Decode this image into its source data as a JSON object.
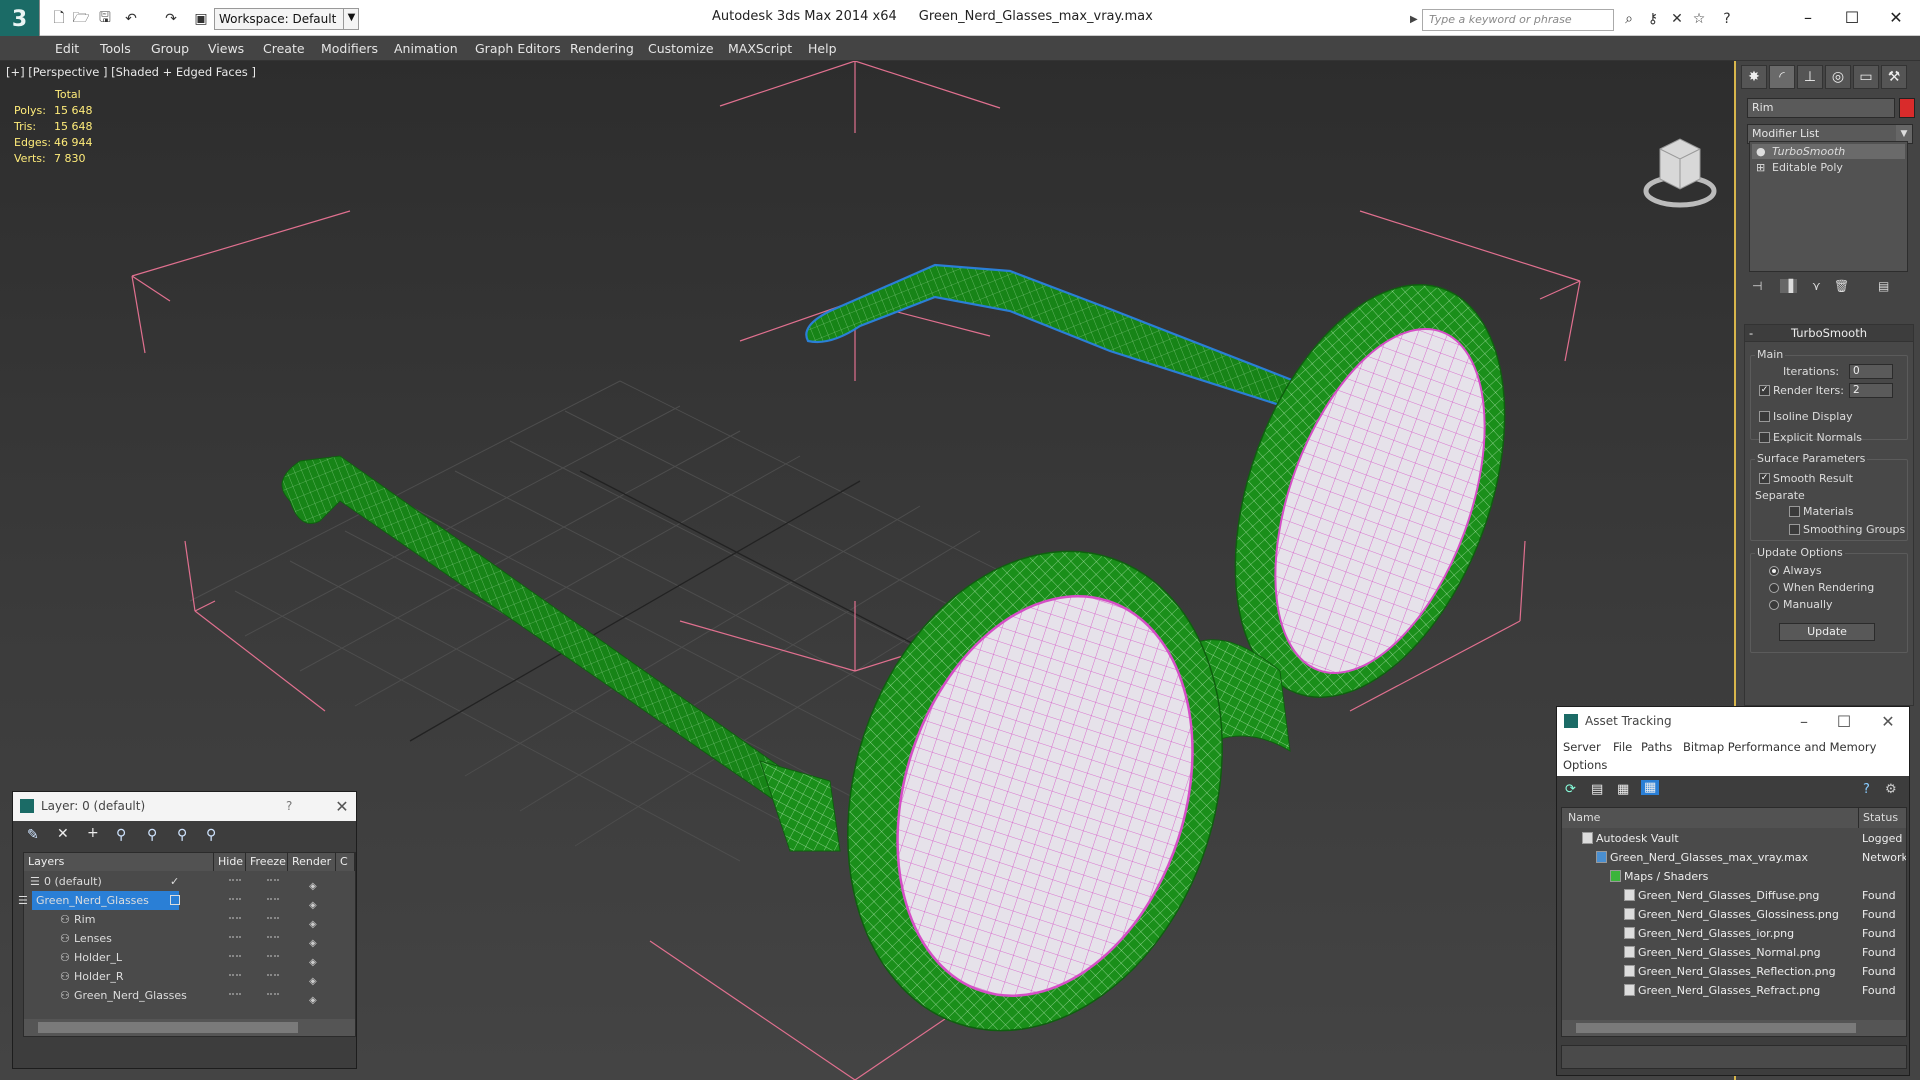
{
  "titlebar": {
    "workspace": "Workspace: Default",
    "app": "Autodesk 3ds Max  2014 x64",
    "file": "Green_Nerd_Glasses_max_vray.max",
    "search_placeholder": "Type a keyword or phrase"
  },
  "menu": [
    "Edit",
    "Tools",
    "Group",
    "Views",
    "Create",
    "Modifiers",
    "Animation",
    "Graph Editors",
    "Rendering",
    "Customize",
    "MAXScript",
    "Help"
  ],
  "viewport": {
    "label": "[+] [Perspective ] [Shaded + Edged Faces ]",
    "stats": {
      "header": "Total",
      "rows": [
        {
          "k": "Polys:",
          "v": "15 648"
        },
        {
          "k": "Tris:",
          "v": "15 648"
        },
        {
          "k": "Edges:",
          "v": "46 944"
        },
        {
          "k": "Verts:",
          "v": "7 830"
        }
      ]
    }
  },
  "command_panel": {
    "object_name": "Rim",
    "object_color": "#d92b2b",
    "modifier_list": "Modifier List",
    "stack": [
      "TurboSmooth",
      "Editable Poly"
    ],
    "turbosmooth": {
      "title": "TurboSmooth",
      "main_label": "Main",
      "iterations_label": "Iterations:",
      "iterations": "0",
      "render_iters_label": "Render Iters:",
      "render_iters": "2",
      "render_iters_checked": true,
      "isoline": "Isoline Display",
      "explicit": "Explicit Normals",
      "surface_label": "Surface Parameters",
      "smooth_result": "Smooth Result",
      "separate_label": "Separate",
      "materials": "Materials",
      "smoothing_groups": "Smoothing Groups",
      "update_options_label": "Update Options",
      "always": "Always",
      "when_rendering": "When Rendering",
      "manually": "Manually",
      "update_button": "Update"
    }
  },
  "layer_dialog": {
    "title": "Layer: 0 (default)",
    "help": "?",
    "columns": [
      "Layers",
      "Hide",
      "Freeze",
      "Render",
      "C"
    ],
    "rows": [
      {
        "name": "0 (default)",
        "indent": 0
      },
      {
        "name": "Green_Nerd_Glasses",
        "indent": 0,
        "selected": true
      },
      {
        "name": "Rim",
        "indent": 1
      },
      {
        "name": "Lenses",
        "indent": 1
      },
      {
        "name": "Holder_L",
        "indent": 1
      },
      {
        "name": "Holder_R",
        "indent": 1
      },
      {
        "name": "Green_Nerd_Glasses",
        "indent": 1
      }
    ]
  },
  "asset_dialog": {
    "title": "Asset Tracking",
    "menu": [
      "Server",
      "File",
      "Paths",
      "Bitmap Performance and Memory",
      "Options"
    ],
    "columns": [
      "Name",
      "Status"
    ],
    "rows": [
      {
        "name": "Autodesk Vault",
        "status": "Logged O",
        "indent": 0
      },
      {
        "name": "Green_Nerd_Glasses_max_vray.max",
        "status": "Network",
        "indent": 1
      },
      {
        "name": "Maps / Shaders",
        "status": "",
        "indent": 2
      },
      {
        "name": "Green_Nerd_Glasses_Diffuse.png",
        "status": "Found",
        "indent": 3
      },
      {
        "name": "Green_Nerd_Glasses_Glossiness.png",
        "status": "Found",
        "indent": 3
      },
      {
        "name": "Green_Nerd_Glasses_ior.png",
        "status": "Found",
        "indent": 3
      },
      {
        "name": "Green_Nerd_Glasses_Normal.png",
        "status": "Found",
        "indent": 3
      },
      {
        "name": "Green_Nerd_Glasses_Reflection.png",
        "status": "Found",
        "indent": 3
      },
      {
        "name": "Green_Nerd_Glasses_Refract.png",
        "status": "Found",
        "indent": 3
      }
    ]
  },
  "colors": {
    "frame_green": "#1f8a1f",
    "lens_pink": "#e86fd0",
    "bbox_pink": "#e0708f",
    "selection_blue": "#2a7fd6"
  }
}
